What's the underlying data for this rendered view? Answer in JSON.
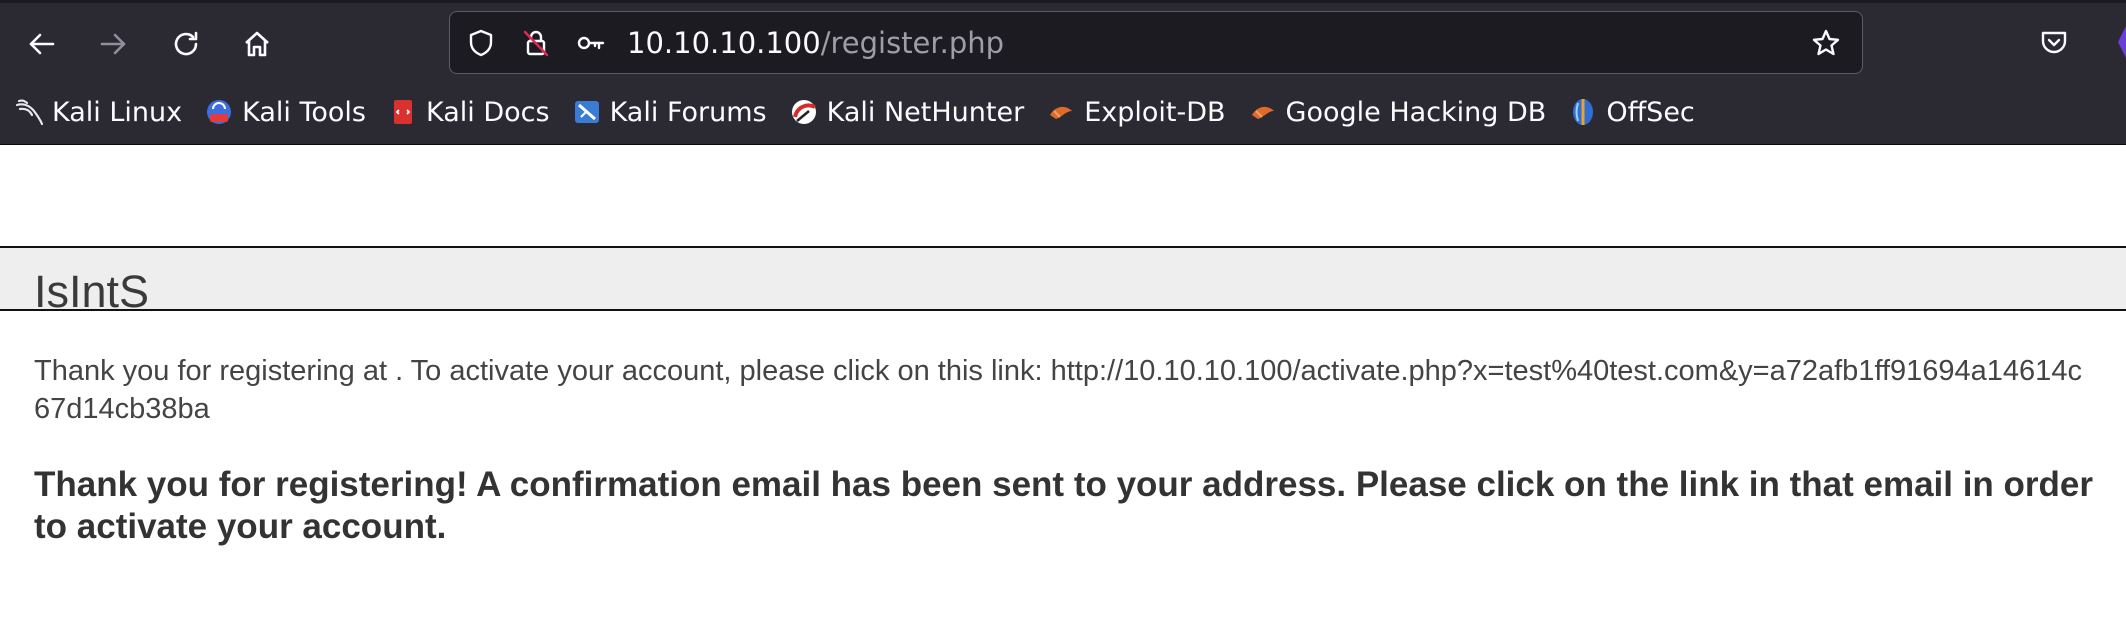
{
  "browser": {
    "url": {
      "host": "10.10.10.100",
      "path": "/register.php"
    },
    "bookmarks": [
      {
        "label": "Kali Linux",
        "icon": "kali-dragon-icon"
      },
      {
        "label": "Kali Tools",
        "icon": "kali-tools-icon"
      },
      {
        "label": "Kali Docs",
        "icon": "kali-docs-icon"
      },
      {
        "label": "Kali Forums",
        "icon": "kali-forums-icon"
      },
      {
        "label": "Kali NetHunter",
        "icon": "kali-nethunter-icon"
      },
      {
        "label": "Exploit-DB",
        "icon": "exploit-db-icon"
      },
      {
        "label": "Google Hacking DB",
        "icon": "google-hacking-db-icon"
      },
      {
        "label": "OffSec",
        "icon": "offsec-icon"
      }
    ],
    "colors": {
      "chrome_bg": "#2b2a33",
      "urlbar_bg": "#1c1b22",
      "text": "#fbfbfe"
    }
  },
  "page": {
    "site_title": "IsIntS",
    "activation_message": "Thank you for registering at . To activate your account, please click on this link: http://10.10.10.100/activate.php?x=test%40test.com&y=a72afb1ff91694a14614c67d14cb38ba",
    "confirmation_message": "Thank you for registering! A confirmation email has been sent to your address. Please click on the link in that email in order to activate your account."
  }
}
